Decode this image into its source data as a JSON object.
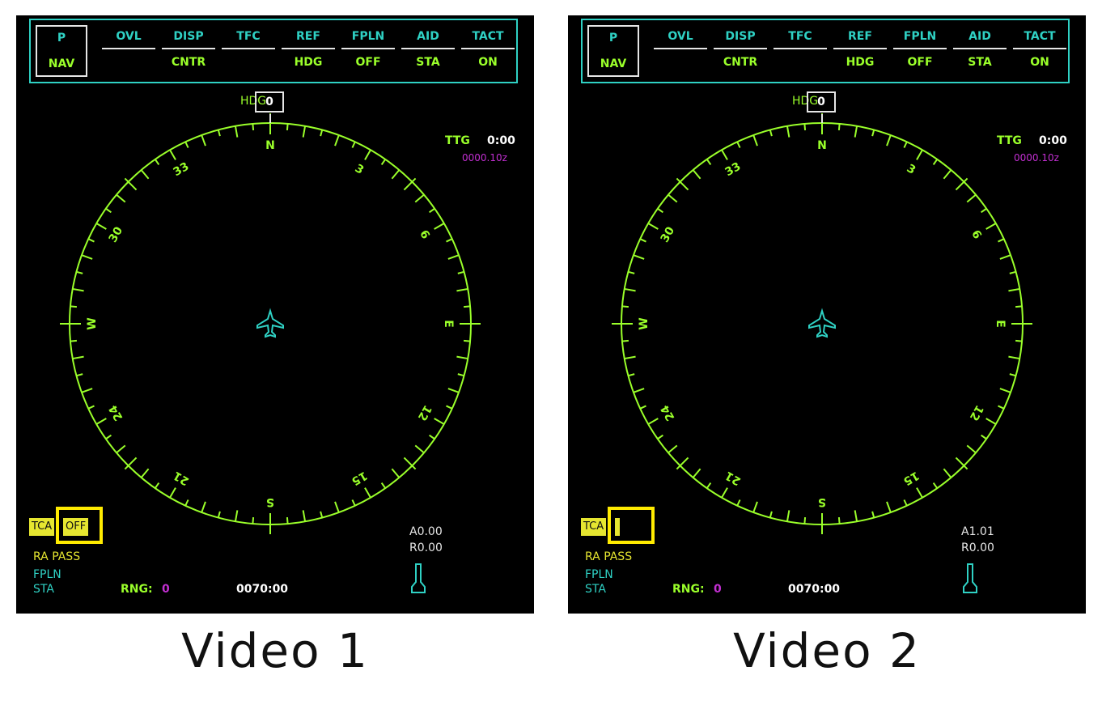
{
  "colors": {
    "green": "#9aff2a",
    "cyan": "#2fd1c4",
    "magenta": "#c22fd1",
    "yellow": "#e6e630",
    "white": "#e6e6e6"
  },
  "panels": [
    {
      "caption": "Video 1",
      "pnav": {
        "top": "P",
        "bottom": "NAV"
      },
      "buttons": [
        {
          "top": "OVL",
          "bottom": ""
        },
        {
          "top": "DISP",
          "bottom": "CNTR"
        },
        {
          "top": "TFC",
          "bottom": ""
        },
        {
          "top": "REF",
          "bottom": "HDG"
        },
        {
          "top": "FPLN",
          "bottom": "OFF"
        },
        {
          "top": "AID",
          "bottom": "STA"
        },
        {
          "top": "TACT",
          "bottom": "ON"
        }
      ],
      "hdg_label": "HDG",
      "hdg_value": "0",
      "ttg_label": "TTG",
      "ttg_value": "0:00",
      "zulu": "0000.10z",
      "compass": {
        "cardinals": [
          "N",
          "E",
          "S",
          "W"
        ],
        "numbers": [
          "3",
          "6",
          "12",
          "15",
          "21",
          "24",
          "30",
          "33"
        ]
      },
      "tcas_label": "TCA",
      "tcas_value": "OFF",
      "ra": "RA PASS",
      "fpln": "FPLN",
      "sta": "STA",
      "rng_label": "RNG:",
      "rng_value": "0",
      "clock": "0070:00",
      "alt": "A0.00",
      "rr": "R0.00"
    },
    {
      "caption": "Video 2",
      "pnav": {
        "top": "P",
        "bottom": "NAV"
      },
      "buttons": [
        {
          "top": "OVL",
          "bottom": ""
        },
        {
          "top": "DISP",
          "bottom": "CNTR"
        },
        {
          "top": "TFC",
          "bottom": ""
        },
        {
          "top": "REF",
          "bottom": "HDG"
        },
        {
          "top": "FPLN",
          "bottom": "OFF"
        },
        {
          "top": "AID",
          "bottom": "STA"
        },
        {
          "top": "TACT",
          "bottom": "ON"
        }
      ],
      "hdg_label": "HDG",
      "hdg_value": "0",
      "ttg_label": "TTG",
      "ttg_value": "0:00",
      "zulu": "0000.10z",
      "compass": {
        "cardinals": [
          "N",
          "E",
          "S",
          "W"
        ],
        "numbers": [
          "3",
          "6",
          "12",
          "15",
          "21",
          "24",
          "30",
          "33"
        ]
      },
      "tcas_label": "TCA",
      "tcas_value": "",
      "ra": "RA PASS",
      "fpln": "FPLN",
      "sta": "STA",
      "rng_label": "RNG:",
      "rng_value": "0",
      "clock": "0070:00",
      "alt": "A1.01",
      "rr": "R0.00"
    }
  ]
}
